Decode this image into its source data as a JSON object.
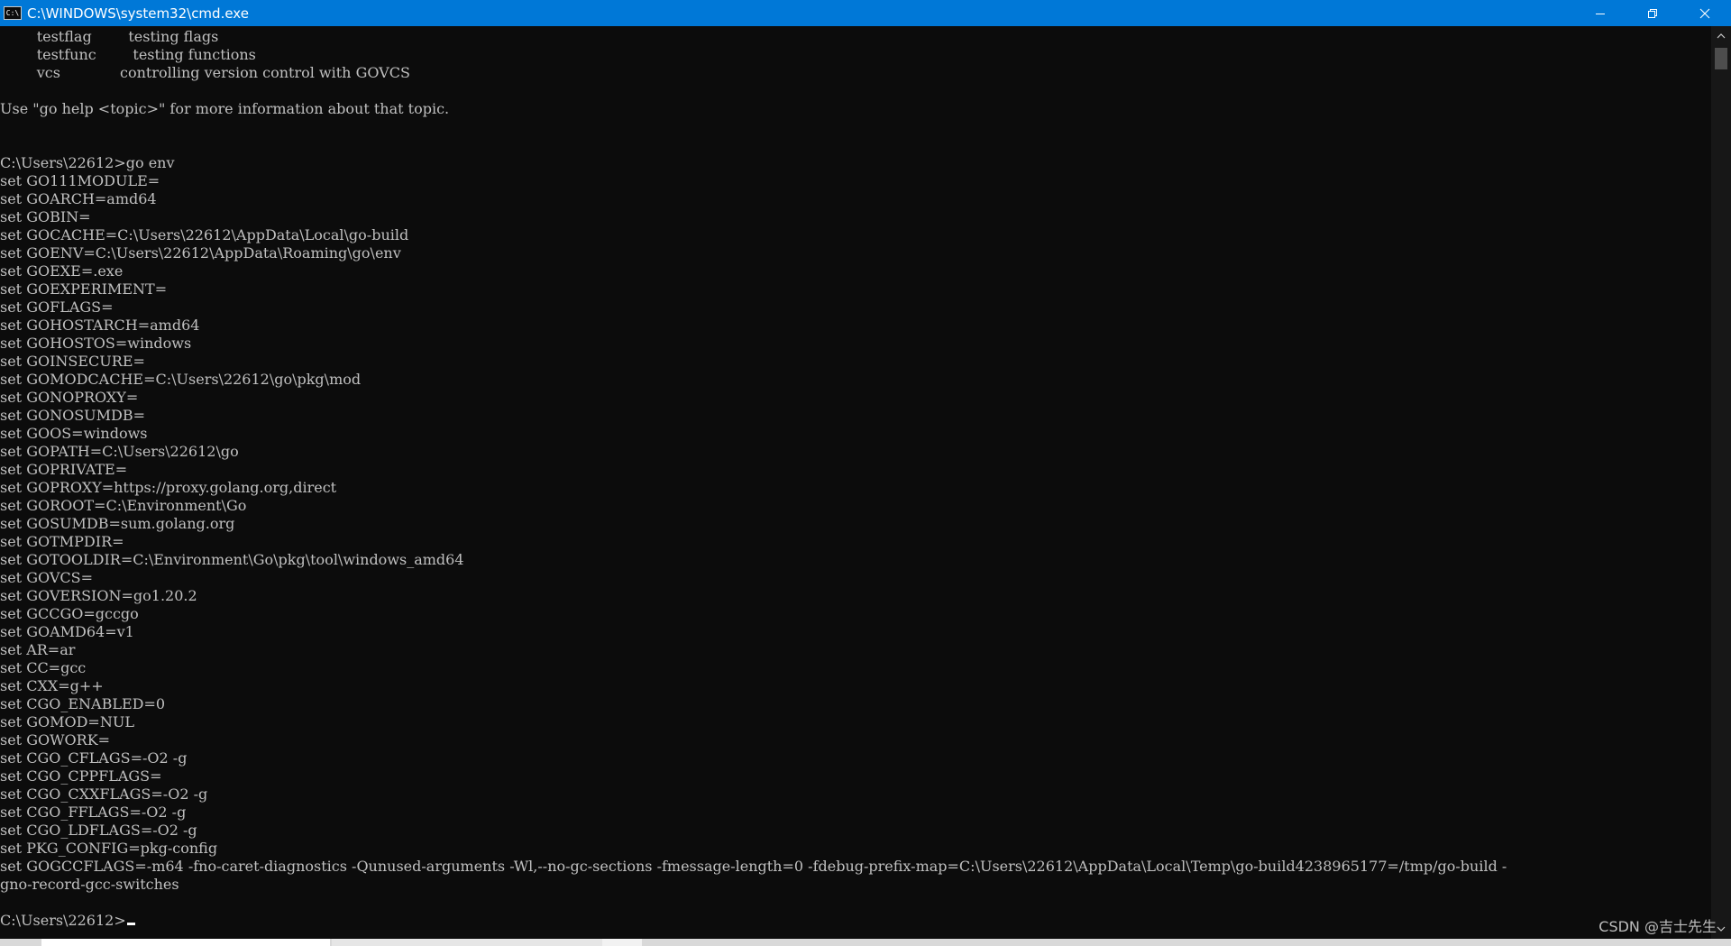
{
  "window": {
    "title": "C:\\WINDOWS\\system32\\cmd.exe",
    "icon_label": "C:\\",
    "buttons": [
      "minimize-icon",
      "restore-icon",
      "close-icon"
    ],
    "title_bar_color": "#0078d7"
  },
  "console": {
    "background_color": "#0c0c0c",
    "text_color": "#c0c0c0",
    "lines": [
      "        testflag        testing flags",
      "        testfunc        testing functions",
      "        vcs             controlling version control with GOVCS",
      "",
      "Use \"go help <topic>\" for more information about that topic.",
      "",
      "",
      "C:\\Users\\22612>go env",
      "set GO111MODULE=",
      "set GOARCH=amd64",
      "set GOBIN=",
      "set GOCACHE=C:\\Users\\22612\\AppData\\Local\\go-build",
      "set GOENV=C:\\Users\\22612\\AppData\\Roaming\\go\\env",
      "set GOEXE=.exe",
      "set GOEXPERIMENT=",
      "set GOFLAGS=",
      "set GOHOSTARCH=amd64",
      "set GOHOSTOS=windows",
      "set GOINSECURE=",
      "set GOMODCACHE=C:\\Users\\22612\\go\\pkg\\mod",
      "set GONOPROXY=",
      "set GONOSUMDB=",
      "set GOOS=windows",
      "set GOPATH=C:\\Users\\22612\\go",
      "set GOPRIVATE=",
      "set GOPROXY=https://proxy.golang.org,direct",
      "set GOROOT=C:\\Environment\\Go",
      "set GOSUMDB=sum.golang.org",
      "set GOTMPDIR=",
      "set GOTOOLDIR=C:\\Environment\\Go\\pkg\\tool\\windows_amd64",
      "set GOVCS=",
      "set GOVERSION=go1.20.2",
      "set GCCGO=gccgo",
      "set GOAMD64=v1",
      "set AR=ar",
      "set CC=gcc",
      "set CXX=g++",
      "set CGO_ENABLED=0",
      "set GOMOD=NUL",
      "set GOWORK=",
      "set CGO_CFLAGS=-O2 -g",
      "set CGO_CPPFLAGS=",
      "set CGO_CXXFLAGS=-O2 -g",
      "set CGO_FFLAGS=-O2 -g",
      "set CGO_LDFLAGS=-O2 -g",
      "set PKG_CONFIG=pkg-config",
      "set GOGCCFLAGS=-m64 -fno-caret-diagnostics -Qunused-arguments -Wl,--no-gc-sections -fmessage-length=0 -fdebug-prefix-map=C:\\Users\\22612\\AppData\\Local\\Temp\\go-build4238965177=/tmp/go-build -",
      "gno-record-gcc-switches",
      ""
    ],
    "prompt": "C:\\Users\\22612>"
  },
  "scrollbar": {
    "up_icon": "scroll-up-arrow-icon",
    "down_icon": "scroll-down-arrow-icon"
  },
  "watermark": "CSDN @吉士先生"
}
